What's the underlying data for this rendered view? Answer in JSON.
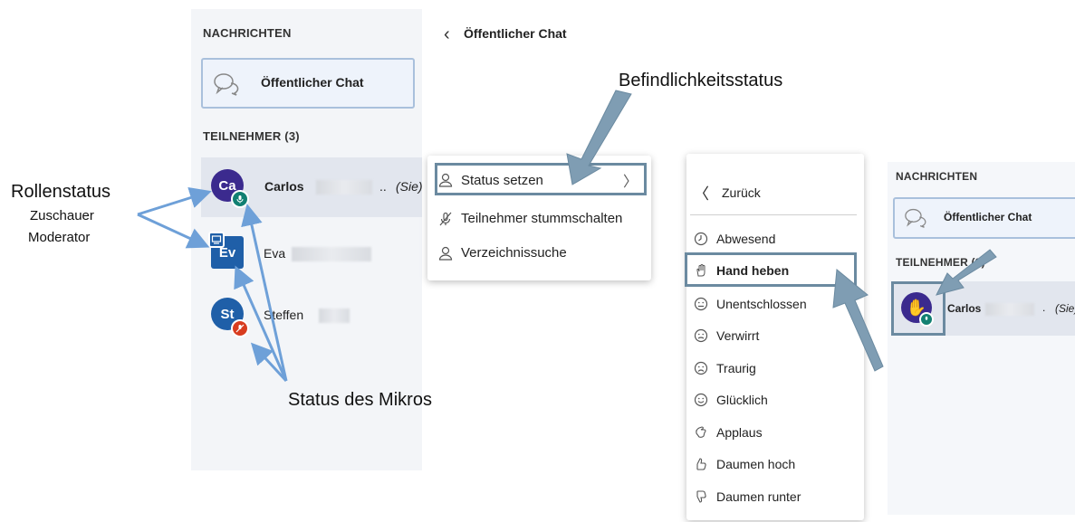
{
  "sidebar": {
    "messages_title": "NACHRICHTEN",
    "public_chat": "Öffentlicher Chat",
    "participants_title": "TEILNEHMER (3)",
    "users": [
      {
        "initials": "Ca",
        "name": "Carlos",
        "suffix": "..",
        "you": "(Sie)"
      },
      {
        "initials": "Ev",
        "name": "Eva"
      },
      {
        "initials": "St",
        "name": "Steffen"
      }
    ]
  },
  "chat_header": {
    "back": "‹",
    "title": "Öffentlicher Chat"
  },
  "user_menu": {
    "items": [
      "Status setzen",
      "Teilnehmer stummschalten",
      "Verzeichnissuche"
    ]
  },
  "status_menu": {
    "back": "Zurück",
    "items": [
      "Abwesend",
      "Hand heben",
      "Unentschlossen",
      "Verwirrt",
      "Traurig",
      "Glücklich",
      "Applaus",
      "Daumen hoch",
      "Daumen runter"
    ]
  },
  "mini_panel": {
    "messages_title": "NACHRICHTEN",
    "public_chat": "Öffentlicher Chat",
    "participants_title": "TEILNEHMER (3)",
    "user_name": "Carlos",
    "user_suffix": ".",
    "user_you": "(Sie)"
  },
  "annotations": {
    "role_status": "Rollenstatus",
    "viewer": "Zuschauer",
    "moderator": "Moderator",
    "mic_status": "Status des Mikros",
    "presence_status": "Befindlichkeitsstatus"
  },
  "colors": {
    "avatar_ca": "#3b2a8e",
    "avatar_ev": "#1f5fa8",
    "avatar_st": "#1f5fa8",
    "mic_on": "#128072",
    "mic_off": "#d83c1f",
    "highlight": "#6b8aa0",
    "arrow_blue": "#6ea0d8"
  }
}
